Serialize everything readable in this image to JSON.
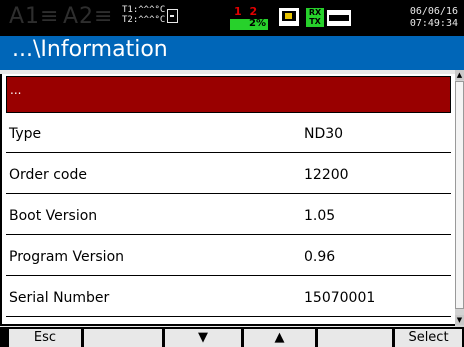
{
  "status": {
    "channels": [
      "A1≡",
      "A2≡"
    ],
    "temps": [
      "T1:^^^°C",
      "T2:^^^°C"
    ],
    "relays": "1 2",
    "percent": "2%",
    "rx": "RX",
    "tx": "TX",
    "date": "06/06/16",
    "time": "07:49:34"
  },
  "title": "...\\Information",
  "list": {
    "header": "...",
    "rows": [
      {
        "label": "Type",
        "value": "ND30"
      },
      {
        "label": "Order code",
        "value": "12200"
      },
      {
        "label": "Boot Version",
        "value": "1.05"
      },
      {
        "label": "Program Version",
        "value": "0.96"
      },
      {
        "label": "Serial Number",
        "value": "15070001"
      }
    ]
  },
  "fkeys": {
    "f1": "Esc",
    "f2": "",
    "f3": "▼",
    "f4": "▲",
    "f5": "",
    "f6": "Select"
  },
  "icons": [
    "sd-card-icon",
    "display-icon",
    "rx-tx-icon",
    "modem-icon",
    "scroll-up-icon",
    "scroll-down-icon"
  ],
  "colors": {
    "title_bar": "#0066b8",
    "header_row": "#990000",
    "relay_bar": "#27d12b",
    "relay_numbers": "#e00000"
  }
}
